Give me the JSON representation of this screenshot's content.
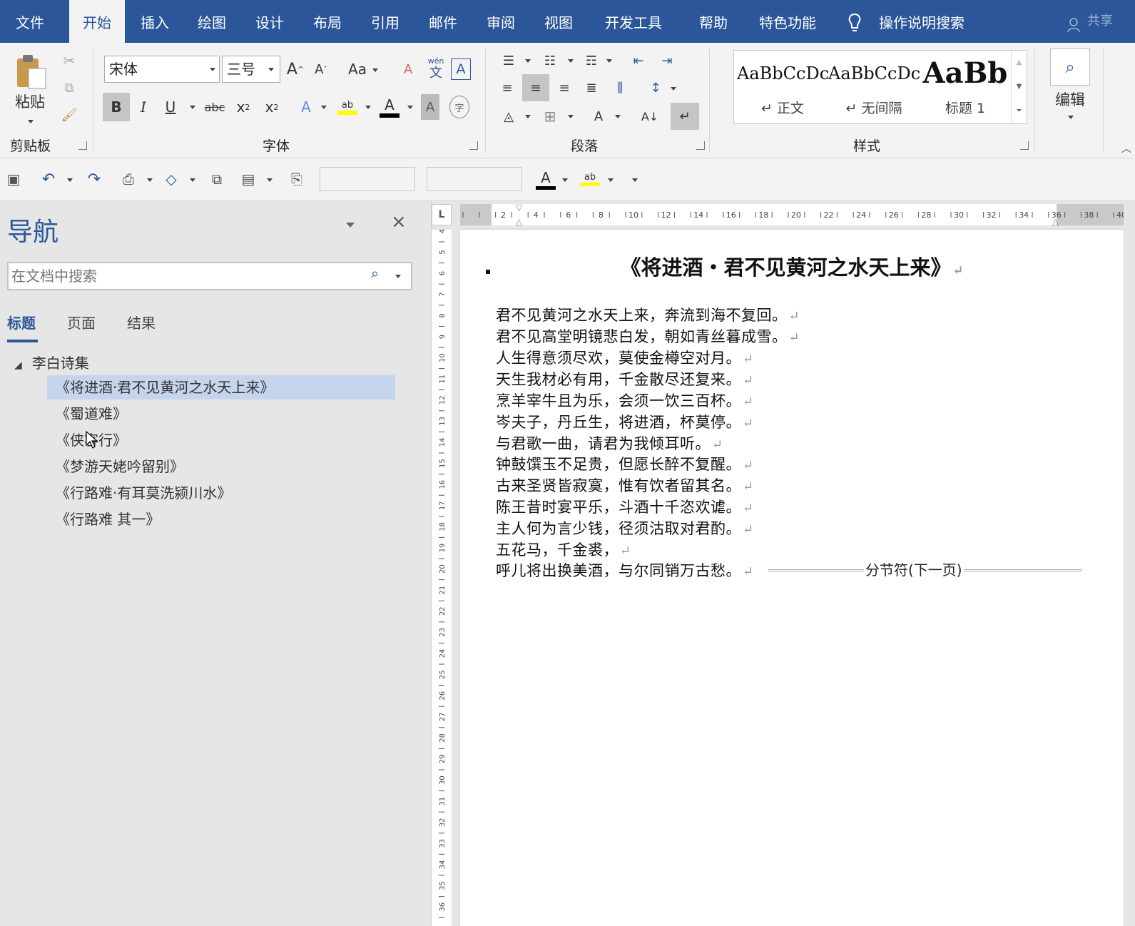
{
  "ribbon": {
    "tabs": [
      "文件",
      "开始",
      "插入",
      "绘图",
      "设计",
      "布局",
      "引用",
      "邮件",
      "审阅",
      "视图",
      "开发工具",
      "帮助",
      "特色功能"
    ],
    "active_tab": "开始",
    "tell_me": "操作说明搜索",
    "share": "共享",
    "clipboard": {
      "label": "剪贴板",
      "paste": "粘贴"
    },
    "font": {
      "label": "字体",
      "font_name": "宋体",
      "font_size": "三号",
      "case_label": "Aa",
      "pinyin_label": "wén",
      "pinyin_char": "文"
    },
    "paragraph": {
      "label": "段落"
    },
    "styles": {
      "label": "样式",
      "items": [
        {
          "sample": "AaBbCcDc",
          "name": "正文"
        },
        {
          "sample": "AaBbCcDc",
          "name": "无间隔"
        },
        {
          "sample": "AaBb",
          "name": "标题 1"
        }
      ]
    },
    "editing": {
      "label": "编辑"
    }
  },
  "navigation": {
    "title": "导航",
    "search_placeholder": "在文档中搜索",
    "tabs": [
      "标题",
      "页面",
      "结果"
    ],
    "active_tab": "标题",
    "root": "李白诗集",
    "headings": [
      "《将进酒·君不见黄河之水天上来》",
      "《蜀道难》",
      "《侠客行》",
      "《梦游天姥吟留别》",
      "《行路难·有耳莫洗颍川水》",
      "《行路难 其一》"
    ],
    "selected_index": 0
  },
  "document": {
    "title": "《将进酒・君不见黄河之水天上来》",
    "lines": [
      "君不见黄河之水天上来，奔流到海不复回。",
      "君不见高堂明镜悲白发，朝如青丝暮成雪。",
      "人生得意须尽欢，莫使金樽空对月。",
      "天生我材必有用，千金散尽还复来。",
      "烹羊宰牛且为乐，会须一饮三百杯。",
      "岑夫子，丹丘生，将进酒，杯莫停。",
      "与君歌一曲，请君为我倾耳听。",
      "钟鼓馔玉不足贵，但愿长醉不复醒。",
      "古来圣贤皆寂寞，惟有饮者留其名。",
      "陈王昔时宴平乐，斗酒十千恣欢谑。",
      "主人何为言少钱，径须沽取对君酌。",
      "五花马，千金裘，",
      "呼儿将出换美酒，与尔同销万古愁。"
    ],
    "paragraph_mark": "↵",
    "section_break": "分节符(下一页)"
  },
  "colors": {
    "accent": "#2b579a",
    "selection": "#c5d5ee",
    "ribbon_bg": "#f3f3f3",
    "highlight": "#ffff00"
  }
}
